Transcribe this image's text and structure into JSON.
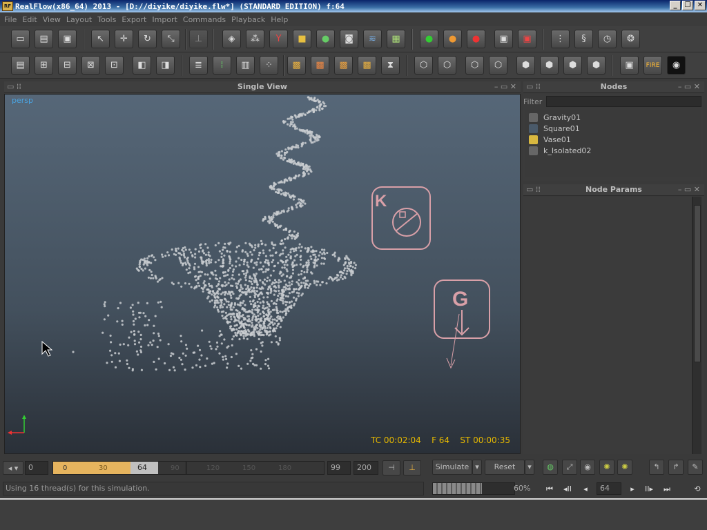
{
  "window": {
    "title": "RealFlow(x86_64) 2013 - [D://diyike/diyike.flw*] (STANDARD EDITION) f:64",
    "logo_text": "RF"
  },
  "menu": [
    "File",
    "Edit",
    "View",
    "Layout",
    "Tools",
    "Export",
    "Import",
    "Commands",
    "Playback",
    "Help"
  ],
  "viewport": {
    "title": "Single View",
    "camera_label": "persp",
    "hud": {
      "timecode": "TC 00:02:04",
      "frame": "F 64",
      "sim_time": "ST 00:00:35"
    },
    "daemons": [
      {
        "letter": "K",
        "name": "k_Isolated02"
      },
      {
        "letter": "G",
        "name": "Gravity01"
      }
    ]
  },
  "nodes_panel": {
    "title": "Nodes",
    "filter_label": "Filter",
    "filter_value": "",
    "items": [
      {
        "label": "Gravity01",
        "icon": "daemon-icon"
      },
      {
        "label": "Square01",
        "icon": "emitter-icon"
      },
      {
        "label": "Vase01",
        "icon": "object-icon"
      },
      {
        "label": "k_Isolated02",
        "icon": "daemon-icon"
      }
    ]
  },
  "params_panel": {
    "title": "Node Params"
  },
  "timeline": {
    "start": "0",
    "range_start": "0",
    "current": "64",
    "ticks": [
      "0",
      "30",
      "90",
      "120",
      "150",
      "180"
    ],
    "end": "99",
    "max": "200"
  },
  "sim_controls": {
    "simulate": "Simulate",
    "reset": "Reset"
  },
  "status": {
    "message": "Using 16 thread(s) for this simulation.",
    "progress_percent": 60,
    "progress_label": "60%",
    "frame_field": "64"
  },
  "colors": {
    "hud": "#e6b800",
    "camera_label": "#4aa3e0",
    "timeline_range": "#e6b45e",
    "daemon_outline": "#d9a0a8"
  }
}
